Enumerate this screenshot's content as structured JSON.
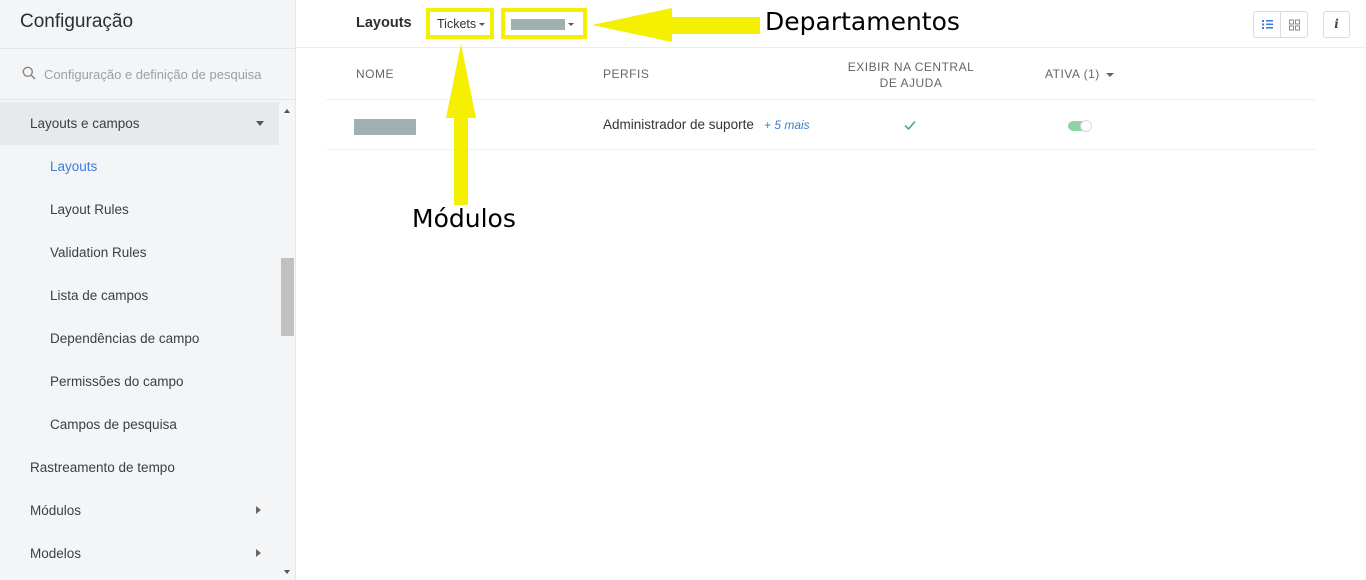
{
  "sidebar": {
    "title": "Configuração",
    "search_placeholder": "Configuração e definição de pesquisa",
    "items": [
      {
        "label": "Layouts e campos",
        "expanded": true
      },
      {
        "label": "Layouts",
        "current": true
      },
      {
        "label": "Layout Rules"
      },
      {
        "label": "Validation Rules"
      },
      {
        "label": "Lista de campos"
      },
      {
        "label": "Dependências de campo"
      },
      {
        "label": "Permissões do campo"
      },
      {
        "label": "Campos de pesquisa"
      },
      {
        "label": "Rastreamento de tempo"
      },
      {
        "label": "Módulos"
      },
      {
        "label": "Modelos"
      }
    ]
  },
  "header": {
    "title": "Layouts",
    "module_selected": "Tickets",
    "department_selected": ""
  },
  "table": {
    "columns": [
      "NOME",
      "PERFIS",
      "EXIBIR NA CENTRAL DE AJUDA",
      "ATIVA (1)"
    ],
    "rows": [
      {
        "name": "",
        "perfil": "Administrador de suporte",
        "more": "+ 5 mais",
        "exibir": true,
        "ativa": true
      }
    ]
  },
  "annotations": {
    "departamentos": "Departamentos",
    "modulos": "Módulos",
    "color": "#f5ef00"
  },
  "colors": {
    "accent": "#3c7dd9",
    "toggle_on": "#8fd4a6",
    "check": "#4caf72"
  }
}
